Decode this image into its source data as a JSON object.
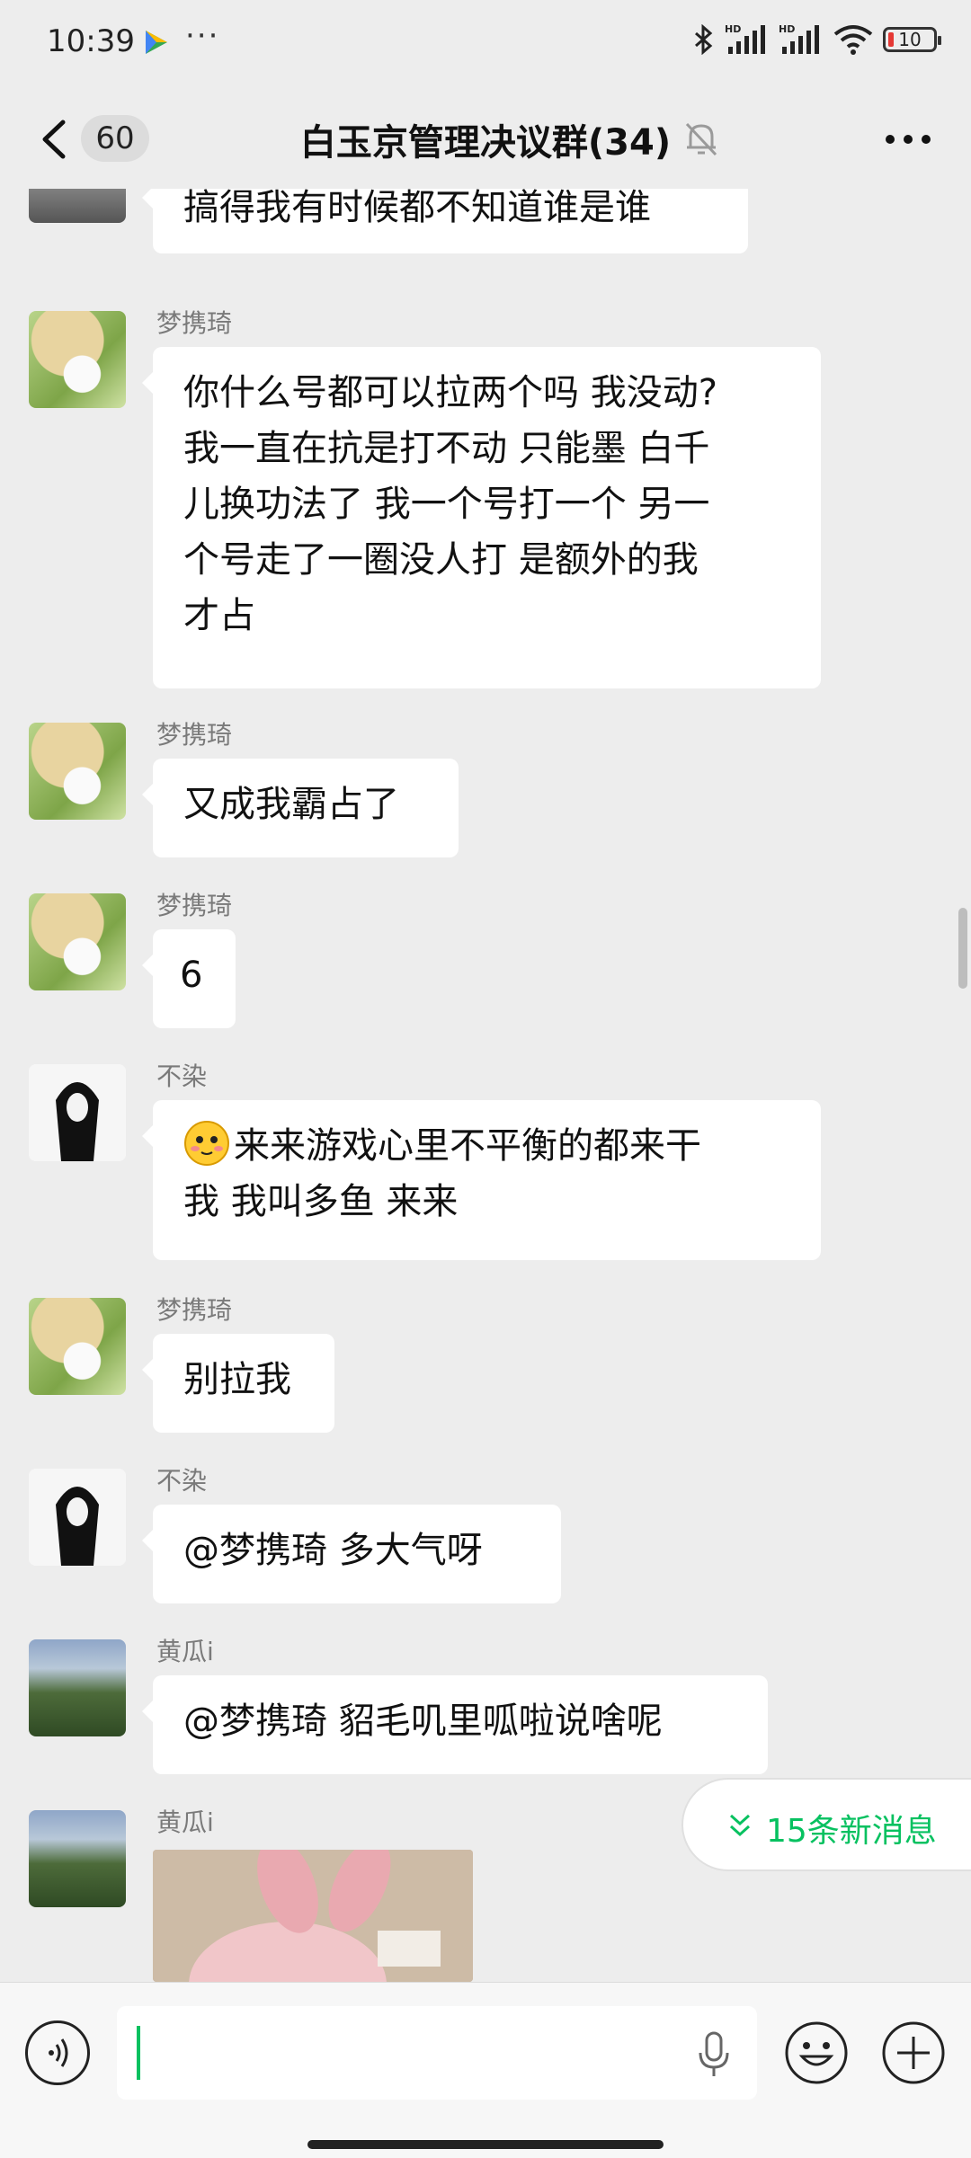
{
  "status_bar": {
    "time": "10:39",
    "more": "···",
    "battery_level": "10",
    "icons": [
      "play-icon",
      "bluetooth-icon",
      "signal-hd-icon",
      "signal-hd-icon",
      "wifi-icon",
      "battery-icon"
    ]
  },
  "header": {
    "back_icon": "chevron-left-icon",
    "unread_count": "60",
    "title": "白玉京管理决议群(34)",
    "mute_icon": "bell-muted-icon",
    "more_icon": "more-icon"
  },
  "messages": [
    {
      "sender": "",
      "text": "搞得我有时候都不知道谁是谁"
    },
    {
      "sender": "梦携琦",
      "text": "你什么号都可以拉两个吗 我没动?\n我一直在抗是打不动 只能墨 白千\n儿换功法了 我一个号打一个 另一\n个号走了一圈没人打 是额外的我\n才占"
    },
    {
      "sender": "梦携琦",
      "text": "又成我霸占了"
    },
    {
      "sender": "梦携琦",
      "text": "6"
    },
    {
      "sender": "不染",
      "text": "来来游戏心里不平衡的都来干\n我  我叫多鱼 来来",
      "emoji": "blush-emoji"
    },
    {
      "sender": "梦携琦",
      "text": "别拉我"
    },
    {
      "sender": "不染",
      "text": "@梦携琦  多大气呀"
    },
    {
      "sender": "黄瓜i",
      "text": "@梦携琦  貂毛叽里呱啦说啥呢"
    },
    {
      "sender": "黄瓜i",
      "text": ""
    }
  ],
  "new_messages_pill": "15条新消息",
  "input": {
    "value": "",
    "placeholder": ""
  }
}
